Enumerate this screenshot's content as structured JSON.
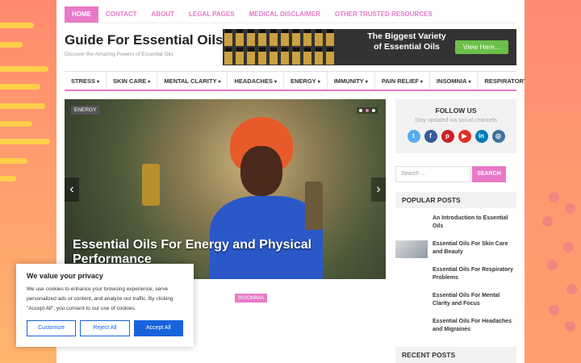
{
  "top_nav": [
    "Home",
    "Contact",
    "About",
    "Legal Pages",
    "Medical Disclaimer",
    "Other Trusted Resources"
  ],
  "site": {
    "title": "Guide For Essential Oils",
    "tagline": "Discover the Amazing Powers of Essential Oils"
  },
  "banner": {
    "text": "The Biggest Variety of Essential Oils",
    "button": "View Here..."
  },
  "main_nav": [
    "STRESS",
    "SKIN CARE",
    "MENTAL CLARITY",
    "HEADACHES",
    "ENERGY",
    "IMMUNITY",
    "PAIN RELIEF",
    "INSOMNIA",
    "RESPIRATORY"
  ],
  "slider": {
    "category": "ENERGY",
    "caption": "Essential Oils For Energy and Physical Performance",
    "slide_count": 3,
    "active_slide": 2
  },
  "post_tag": "INSOMNIA",
  "sidebar": {
    "follow_title": "FOLLOW US",
    "follow_sub": "Stay updated via social channels",
    "socials": [
      {
        "icon": "twitter-icon",
        "glyph": "t",
        "color": "#55acee"
      },
      {
        "icon": "facebook-icon",
        "glyph": "f",
        "color": "#3b5998"
      },
      {
        "icon": "pinterest-icon",
        "glyph": "p",
        "color": "#cb2027"
      },
      {
        "icon": "youtube-icon",
        "glyph": "▶",
        "color": "#e52d27"
      },
      {
        "icon": "linkedin-icon",
        "glyph": "in",
        "color": "#007bb6"
      },
      {
        "icon": "instagram-icon",
        "glyph": "◎",
        "color": "#3f729b"
      }
    ],
    "search_placeholder": "Search ...",
    "search_button": "SEARCH",
    "popular_title": "POPULAR POSTS",
    "popular_posts": [
      "An Introduction to Essential Oils",
      "Essential Oils For Skin Care and Beauty",
      "Essential Oils For Respiratory Problems",
      "Essential Oils For Mental Clarity and Focus",
      "Essential Oils For Headaches and Migraines"
    ],
    "recent_title": "RECENT POSTS"
  },
  "cookie": {
    "title": "We value your privacy",
    "body": "We use cookies to enhance your browsing experience, serve personalized ads or content, and analyze our traffic. By clicking \"Accept All\", you consent to our use of cookies.",
    "customize": "Customize",
    "reject": "Reject All",
    "accept": "Accept All"
  },
  "colors": {
    "accent": "#e879c8",
    "cookie_blue": "#1863dc",
    "banner_button": "#6cc04a"
  }
}
